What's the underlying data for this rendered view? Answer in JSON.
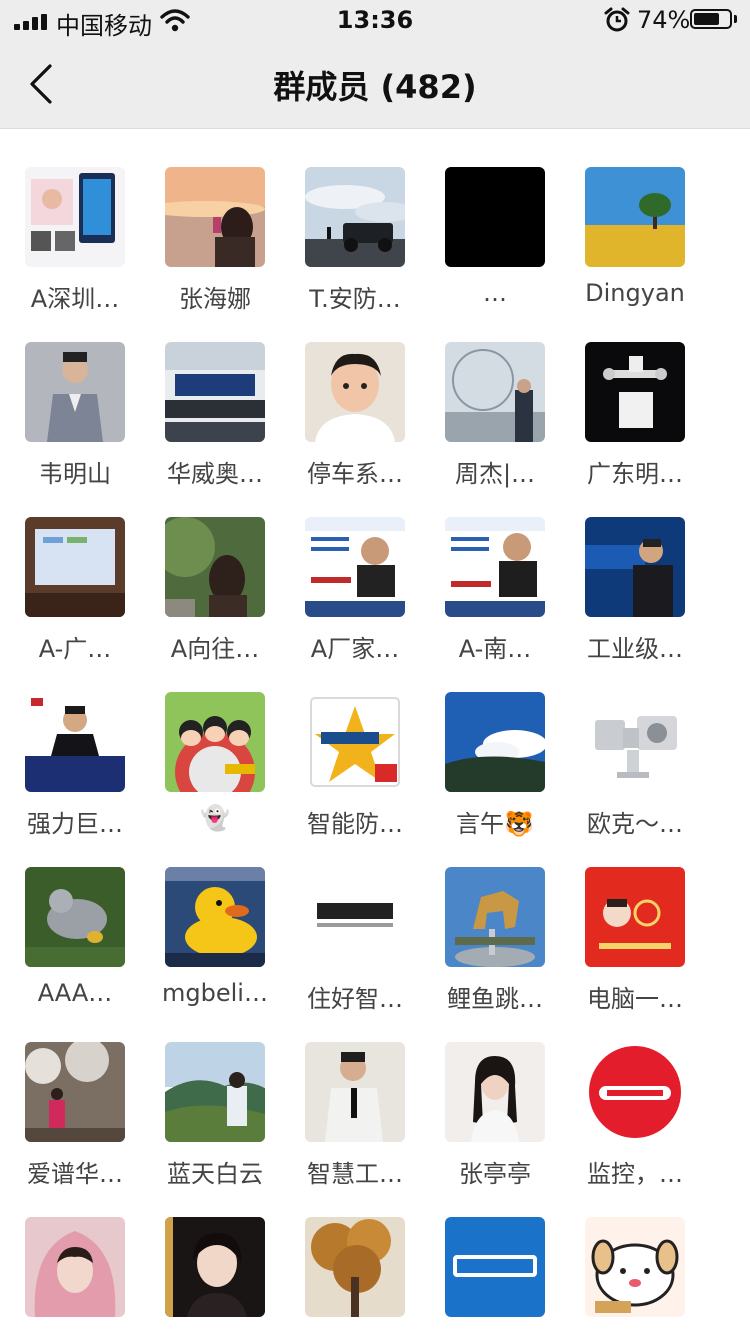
{
  "status_bar": {
    "carrier": "中国移动",
    "time": "13:36",
    "battery_percent": "74%",
    "battery_level": 0.74
  },
  "header": {
    "title": "群成员 (482)",
    "back_icon": "chevron-left-icon"
  },
  "members": [
    {
      "name": "A深圳…",
      "avatar": "display-kiosk-photo"
    },
    {
      "name": "张海娜",
      "avatar": "woman-sunset-photo"
    },
    {
      "name": "T.安防…",
      "avatar": "jeep-sky-photo"
    },
    {
      "name": "…",
      "avatar": "black-square"
    },
    {
      "name": "Dingyan",
      "avatar": "tree-field-photo"
    },
    {
      "name": "韦明山",
      "avatar": "man-suit-photo"
    },
    {
      "name": "华威奥…",
      "avatar": "control-room-photo"
    },
    {
      "name": "停车系…",
      "avatar": "child-portrait-photo"
    },
    {
      "name": "周杰|…",
      "avatar": "ferris-wheel-photo"
    },
    {
      "name": "广东明…",
      "avatar": "robot-arm-photo"
    },
    {
      "name": "A-广…",
      "avatar": "projector-screen-photo"
    },
    {
      "name": "A向往…",
      "avatar": "woman-garden-photo"
    },
    {
      "name": "A厂家…",
      "avatar": "business-card-man"
    },
    {
      "name": "A-南…",
      "avatar": "business-card-man-2"
    },
    {
      "name": "工业级…",
      "avatar": "man-blue-banner"
    },
    {
      "name": "强力巨…",
      "avatar": "man-navy-card"
    },
    {
      "name": "👻",
      "avatar": "cartoon-group"
    },
    {
      "name": "智能防…",
      "avatar": "star-logo"
    },
    {
      "name": "言午🐯",
      "avatar": "blue-sky-photo"
    },
    {
      "name": "欧克～…",
      "avatar": "ptz-camera-photo"
    },
    {
      "name": "AAA…",
      "avatar": "plush-toy-grass"
    },
    {
      "name": "mgbeli…",
      "avatar": "yellow-duck-photo"
    },
    {
      "name": "住好智…",
      "avatar": "hogood-logo"
    },
    {
      "name": "鲤鱼跳…",
      "avatar": "horse-statue-photo"
    },
    {
      "name": "电脑一…",
      "avatar": "red-new-year-card"
    },
    {
      "name": "爱谱华…",
      "avatar": "child-blossom-photo"
    },
    {
      "name": "蓝天白云",
      "avatar": "mountain-view-photo"
    },
    {
      "name": "智慧工…",
      "avatar": "man-white-suit-photo"
    },
    {
      "name": "张亭亭",
      "avatar": "woman-portrait-photo"
    },
    {
      "name": "监控，…",
      "avatar": "alhua-red-logo"
    },
    {
      "name": "",
      "avatar": "pink-hood-photo"
    },
    {
      "name": "",
      "avatar": "woman-selfie-photo"
    },
    {
      "name": "",
      "avatar": "autumn-tree-photo"
    },
    {
      "name": "",
      "avatar": "tp-link-logo"
    },
    {
      "name": "",
      "avatar": "cartoon-dog"
    }
  ]
}
